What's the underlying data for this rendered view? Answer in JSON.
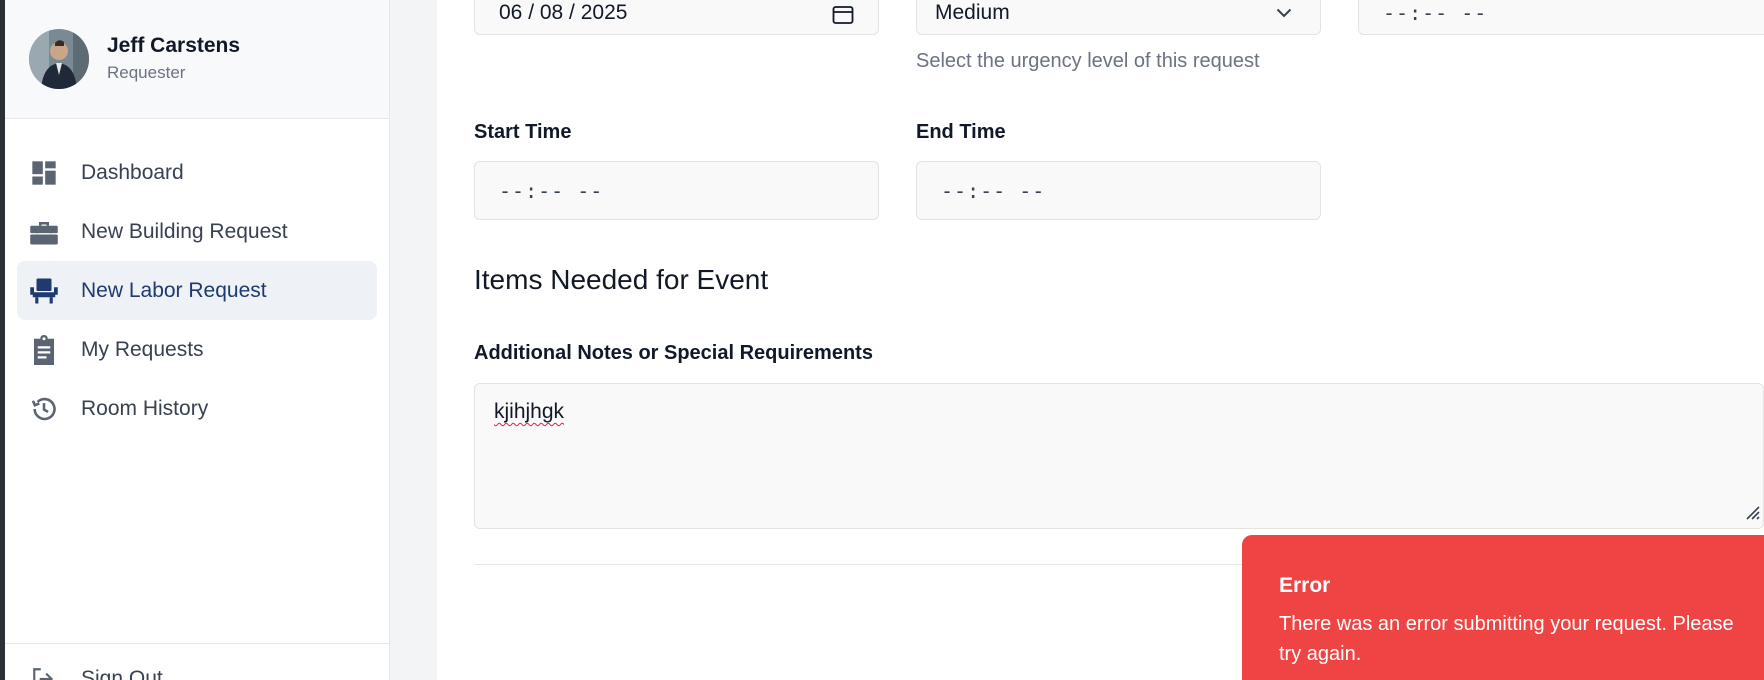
{
  "user": {
    "name": "Jeff Carstens",
    "role": "Requester"
  },
  "nav": [
    {
      "label": "Dashboard",
      "icon": "dashboard-icon"
    },
    {
      "label": "New Building Request",
      "icon": "toolbox-icon"
    },
    {
      "label": "New Labor Request",
      "icon": "chair-icon",
      "active": true
    },
    {
      "label": "My Requests",
      "icon": "clipboard-icon"
    },
    {
      "label": "Room History",
      "icon": "history-icon"
    }
  ],
  "footer": {
    "signout_label": "Sign Out"
  },
  "form": {
    "date_value": "06 / 08 / 2025",
    "priority_value": "Medium",
    "priority_help": "Select the urgency level of this request",
    "top_time_value": "--:-- --",
    "start_time_label": "Start Time",
    "start_time_value": "--:-- --",
    "end_time_label": "End Time",
    "end_time_value": "--:-- --",
    "items_section_title": "Items Needed for Event",
    "notes_label": "Additional Notes or Special Requirements",
    "notes_value": "kjihjhgk"
  },
  "toast": {
    "title": "Error",
    "message": "There was an error submitting your request. Please try again.",
    "color": "#ef4444"
  }
}
